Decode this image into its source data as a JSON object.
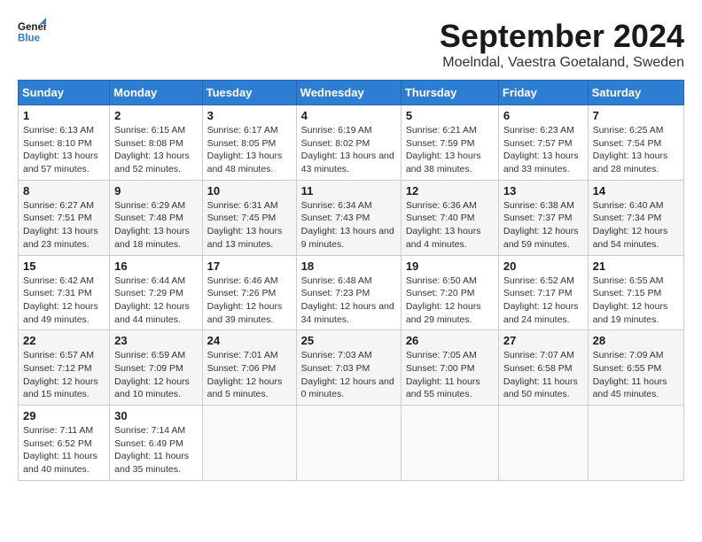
{
  "header": {
    "logo_line1": "General",
    "logo_line2": "Blue",
    "month_title": "September 2024",
    "location": "Moelndal, Vaestra Goetaland, Sweden"
  },
  "weekdays": [
    "Sunday",
    "Monday",
    "Tuesday",
    "Wednesday",
    "Thursday",
    "Friday",
    "Saturday"
  ],
  "weeks": [
    [
      {
        "day": "1",
        "sunrise": "Sunrise: 6:13 AM",
        "sunset": "Sunset: 8:10 PM",
        "daylight": "Daylight: 13 hours and 57 minutes."
      },
      {
        "day": "2",
        "sunrise": "Sunrise: 6:15 AM",
        "sunset": "Sunset: 8:08 PM",
        "daylight": "Daylight: 13 hours and 52 minutes."
      },
      {
        "day": "3",
        "sunrise": "Sunrise: 6:17 AM",
        "sunset": "Sunset: 8:05 PM",
        "daylight": "Daylight: 13 hours and 48 minutes."
      },
      {
        "day": "4",
        "sunrise": "Sunrise: 6:19 AM",
        "sunset": "Sunset: 8:02 PM",
        "daylight": "Daylight: 13 hours and 43 minutes."
      },
      {
        "day": "5",
        "sunrise": "Sunrise: 6:21 AM",
        "sunset": "Sunset: 7:59 PM",
        "daylight": "Daylight: 13 hours and 38 minutes."
      },
      {
        "day": "6",
        "sunrise": "Sunrise: 6:23 AM",
        "sunset": "Sunset: 7:57 PM",
        "daylight": "Daylight: 13 hours and 33 minutes."
      },
      {
        "day": "7",
        "sunrise": "Sunrise: 6:25 AM",
        "sunset": "Sunset: 7:54 PM",
        "daylight": "Daylight: 13 hours and 28 minutes."
      }
    ],
    [
      {
        "day": "8",
        "sunrise": "Sunrise: 6:27 AM",
        "sunset": "Sunset: 7:51 PM",
        "daylight": "Daylight: 13 hours and 23 minutes."
      },
      {
        "day": "9",
        "sunrise": "Sunrise: 6:29 AM",
        "sunset": "Sunset: 7:48 PM",
        "daylight": "Daylight: 13 hours and 18 minutes."
      },
      {
        "day": "10",
        "sunrise": "Sunrise: 6:31 AM",
        "sunset": "Sunset: 7:45 PM",
        "daylight": "Daylight: 13 hours and 13 minutes."
      },
      {
        "day": "11",
        "sunrise": "Sunrise: 6:34 AM",
        "sunset": "Sunset: 7:43 PM",
        "daylight": "Daylight: 13 hours and 9 minutes."
      },
      {
        "day": "12",
        "sunrise": "Sunrise: 6:36 AM",
        "sunset": "Sunset: 7:40 PM",
        "daylight": "Daylight: 13 hours and 4 minutes."
      },
      {
        "day": "13",
        "sunrise": "Sunrise: 6:38 AM",
        "sunset": "Sunset: 7:37 PM",
        "daylight": "Daylight: 12 hours and 59 minutes."
      },
      {
        "day": "14",
        "sunrise": "Sunrise: 6:40 AM",
        "sunset": "Sunset: 7:34 PM",
        "daylight": "Daylight: 12 hours and 54 minutes."
      }
    ],
    [
      {
        "day": "15",
        "sunrise": "Sunrise: 6:42 AM",
        "sunset": "Sunset: 7:31 PM",
        "daylight": "Daylight: 12 hours and 49 minutes."
      },
      {
        "day": "16",
        "sunrise": "Sunrise: 6:44 AM",
        "sunset": "Sunset: 7:29 PM",
        "daylight": "Daylight: 12 hours and 44 minutes."
      },
      {
        "day": "17",
        "sunrise": "Sunrise: 6:46 AM",
        "sunset": "Sunset: 7:26 PM",
        "daylight": "Daylight: 12 hours and 39 minutes."
      },
      {
        "day": "18",
        "sunrise": "Sunrise: 6:48 AM",
        "sunset": "Sunset: 7:23 PM",
        "daylight": "Daylight: 12 hours and 34 minutes."
      },
      {
        "day": "19",
        "sunrise": "Sunrise: 6:50 AM",
        "sunset": "Sunset: 7:20 PM",
        "daylight": "Daylight: 12 hours and 29 minutes."
      },
      {
        "day": "20",
        "sunrise": "Sunrise: 6:52 AM",
        "sunset": "Sunset: 7:17 PM",
        "daylight": "Daylight: 12 hours and 24 minutes."
      },
      {
        "day": "21",
        "sunrise": "Sunrise: 6:55 AM",
        "sunset": "Sunset: 7:15 PM",
        "daylight": "Daylight: 12 hours and 19 minutes."
      }
    ],
    [
      {
        "day": "22",
        "sunrise": "Sunrise: 6:57 AM",
        "sunset": "Sunset: 7:12 PM",
        "daylight": "Daylight: 12 hours and 15 minutes."
      },
      {
        "day": "23",
        "sunrise": "Sunrise: 6:59 AM",
        "sunset": "Sunset: 7:09 PM",
        "daylight": "Daylight: 12 hours and 10 minutes."
      },
      {
        "day": "24",
        "sunrise": "Sunrise: 7:01 AM",
        "sunset": "Sunset: 7:06 PM",
        "daylight": "Daylight: 12 hours and 5 minutes."
      },
      {
        "day": "25",
        "sunrise": "Sunrise: 7:03 AM",
        "sunset": "Sunset: 7:03 PM",
        "daylight": "Daylight: 12 hours and 0 minutes."
      },
      {
        "day": "26",
        "sunrise": "Sunrise: 7:05 AM",
        "sunset": "Sunset: 7:00 PM",
        "daylight": "Daylight: 11 hours and 55 minutes."
      },
      {
        "day": "27",
        "sunrise": "Sunrise: 7:07 AM",
        "sunset": "Sunset: 6:58 PM",
        "daylight": "Daylight: 11 hours and 50 minutes."
      },
      {
        "day": "28",
        "sunrise": "Sunrise: 7:09 AM",
        "sunset": "Sunset: 6:55 PM",
        "daylight": "Daylight: 11 hours and 45 minutes."
      }
    ],
    [
      {
        "day": "29",
        "sunrise": "Sunrise: 7:11 AM",
        "sunset": "Sunset: 6:52 PM",
        "daylight": "Daylight: 11 hours and 40 minutes."
      },
      {
        "day": "30",
        "sunrise": "Sunrise: 7:14 AM",
        "sunset": "Sunset: 6:49 PM",
        "daylight": "Daylight: 11 hours and 35 minutes."
      },
      null,
      null,
      null,
      null,
      null
    ]
  ]
}
